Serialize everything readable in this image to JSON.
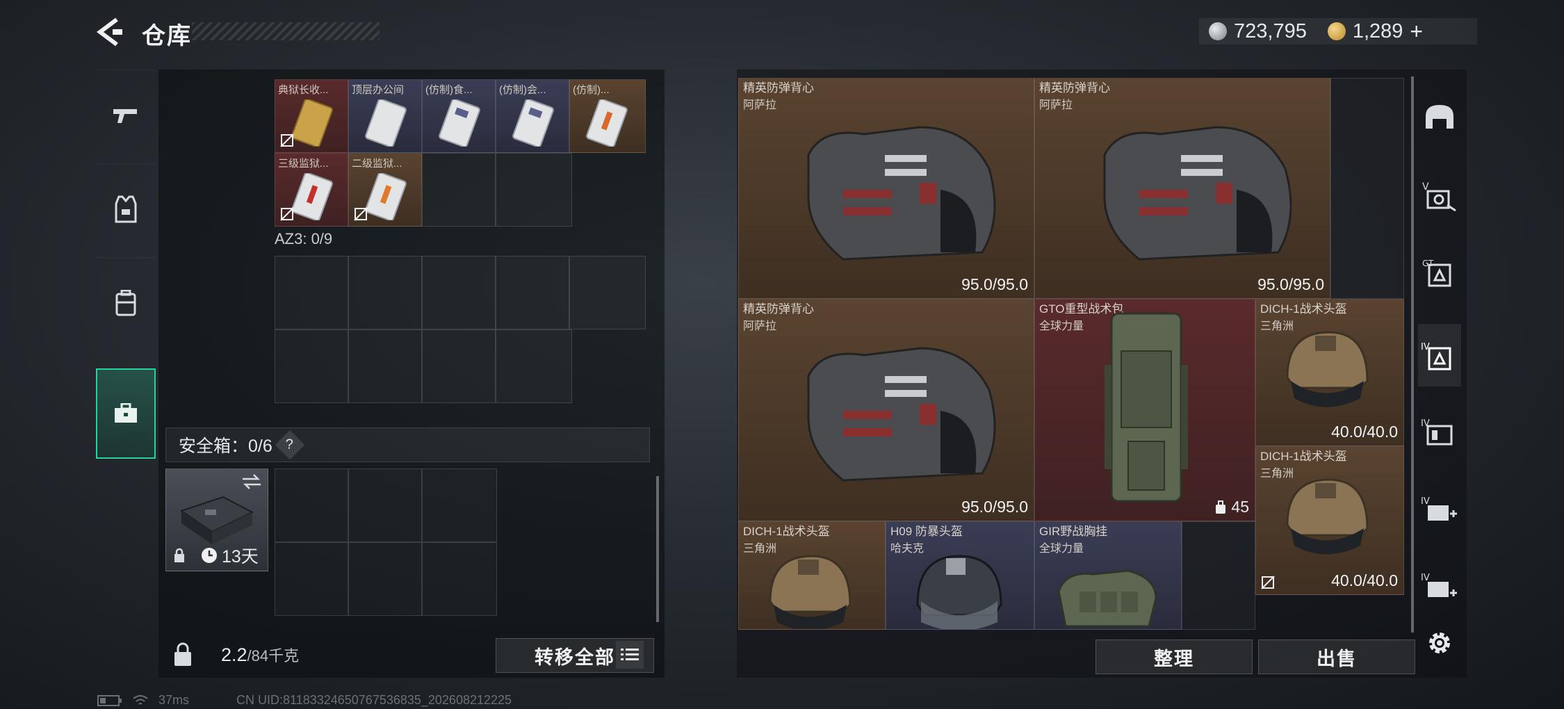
{
  "header": {
    "title": "仓库",
    "silver_amount": "723,795",
    "gold_amount": "1,289",
    "gold_plus": "+"
  },
  "left_tabs": [
    {
      "name": "weapons",
      "icon": "pistol-icon",
      "active": false
    },
    {
      "name": "armor",
      "icon": "vest-icon",
      "active": false
    },
    {
      "name": "backpack",
      "icon": "backpack-icon",
      "active": false
    },
    {
      "name": "container",
      "icon": "briefcase-icon",
      "active": true
    }
  ],
  "container_items": {
    "row1": [
      "典狱长收...",
      "顶层办公间",
      "(仿制)食...",
      "(仿制)会...",
      "(仿制)..."
    ],
    "row2": [
      "三级监狱...",
      "二级监狱..."
    ]
  },
  "az3_label": "AZ3: 0/9",
  "safe_box": {
    "label": "安全箱：0/6",
    "help": "?",
    "timer": "13天"
  },
  "weight": {
    "current": "2.2",
    "max_unit": "/84千克"
  },
  "buttons": {
    "transfer_all": "转移全部",
    "organize": "整理",
    "sell": "出售"
  },
  "warehouse_items": [
    {
      "name": "精英防弹背心",
      "maker": "阿萨拉",
      "durability": "95.0/95.0"
    },
    {
      "name": "精英防弹背心",
      "maker": "阿萨拉",
      "durability": "95.0/95.0"
    },
    {
      "name": "精英防弹背心",
      "maker": "阿萨拉",
      "durability": "95.0/95.0"
    },
    {
      "name": "GTO重型战术包",
      "maker": "全球力量",
      "count": "45"
    },
    {
      "name": "DICH-1战术头盔",
      "maker": "三角洲",
      "durability": "40.0/40.0"
    },
    {
      "name": "DICH-1战术头盔",
      "maker": "三角洲",
      "durability": "40.0/40.0"
    },
    {
      "name": "DICH-1战术头盔",
      "maker": "三角洲"
    },
    {
      "name": "H09 防暴头盔",
      "maker": "哈夫克"
    },
    {
      "name": "GIR野战胸挂",
      "maker": "全球力量"
    }
  ],
  "right_tabs": [
    {
      "icon": "helmet-icon"
    },
    {
      "icon": "armor-v-icon"
    },
    {
      "icon": "backpack-tier-icon"
    },
    {
      "icon": "vest-tier-iv-icon",
      "active": true
    },
    {
      "icon": "rig-iv-icon"
    },
    {
      "icon": "medkit-iv-icon"
    },
    {
      "icon": "ammo-iv-icon"
    },
    {
      "icon": "gear-icon"
    }
  ],
  "footer": {
    "ping": "37ms",
    "uid": "CN UID:81183324650767536835_202608212225"
  },
  "colors": {
    "accent": "#2bd09a",
    "item_red": "#5a2a2c",
    "item_gold": "#5a4330",
    "item_blue": "#3a3d55"
  }
}
